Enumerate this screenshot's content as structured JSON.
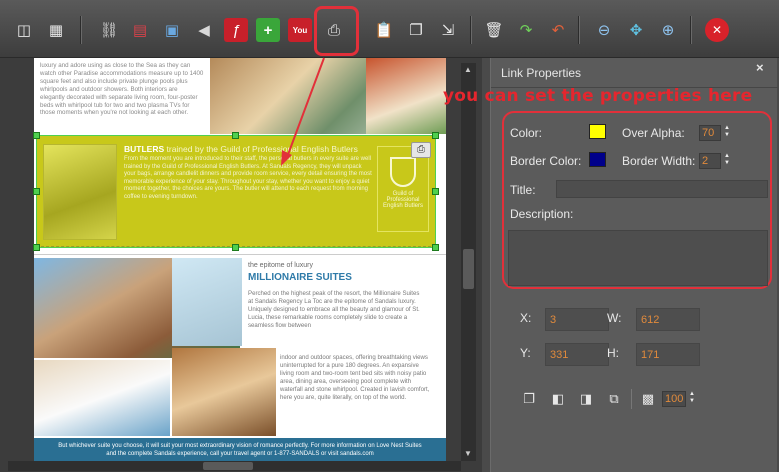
{
  "toolbar": {
    "buttons": [
      {
        "name": "screen-capture-icon",
        "glyph": "◫",
        "color": "#e8e8e8"
      },
      {
        "name": "page-setup-icon",
        "glyph": "▦",
        "color": "#e8e8e8"
      },
      {
        "name": "link-icon",
        "glyph": "⛓",
        "color": "#d8d8d8"
      },
      {
        "name": "video-icon",
        "glyph": "▤",
        "color": "#d8414a"
      },
      {
        "name": "image-icon",
        "glyph": "▣",
        "color": "#6aa8e0"
      },
      {
        "name": "audio-icon",
        "glyph": "◀",
        "color": "#d8d8d8"
      },
      {
        "name": "flash-icon",
        "glyph": "ƒ",
        "color": "#ffffff"
      },
      {
        "name": "add-icon",
        "glyph": "+",
        "color": "#ffffff"
      },
      {
        "name": "youtube-icon",
        "glyph": "You",
        "color": "#ffffff"
      },
      {
        "name": "print-icon",
        "glyph": "⎙",
        "color": "#e8e8e8"
      },
      {
        "name": "paste-icon",
        "glyph": "📋",
        "color": "#e6c66a"
      },
      {
        "name": "copy-icon",
        "glyph": "❐",
        "color": "#e8e8e8"
      },
      {
        "name": "export-icon",
        "glyph": "⇲",
        "color": "#e8e8e8"
      },
      {
        "name": "delete-icon",
        "glyph": "🗑",
        "color": "#e8e8e8"
      },
      {
        "name": "redo-icon",
        "glyph": "↷",
        "color": "#6fd05a"
      },
      {
        "name": "undo-icon",
        "glyph": "↶",
        "color": "#e0603a"
      },
      {
        "name": "zoom-out-icon",
        "glyph": "⊖",
        "color": "#8fc4f0"
      },
      {
        "name": "fit-icon",
        "glyph": "✥",
        "color": "#5fc0e0"
      },
      {
        "name": "zoom-in-icon",
        "glyph": "⊕",
        "color": "#8fc4f0"
      },
      {
        "name": "close-icon",
        "glyph": "✕",
        "color": "#ffffff"
      }
    ]
  },
  "page": {
    "top_text": "luxury and adore using as close to the Sea as they can watch other Paradise accommodations measure up to 1400 square feet and also include private plunge pools plus whirlpools and outdoor showers. Both interiors are elegantly decorated with separate living room, four-poster beds with whirlpool tub for two and two plasma TVs for those moments when you're not looking at each other.",
    "butler_title_main": "BUTLERS",
    "butler_title_rest": " trained by the Guild of Professional English Butlers",
    "butler_text": "From the moment you are introduced to their staff, the personal butlers in every suite are well trained by the Guild of Professional English Butlers. At Sandals Regency, they will unpack your bags, arrange candlelit dinners and provide room service, every detail ensuring the most memorable experience of your stay. Throughout your stay, whether you want to enjoy a quiet moment together, the choices are yours. The butler will attend to each request from morning coffee to evening turndown.",
    "crest_text": "Guild of Professional English Butlers",
    "sub_heading": "the epitome of luxury",
    "headline": "MILLIONAIRE SUITES",
    "body_text": "Perched on the highest peak of the resort, the Millionaire Suites at Sandals Regency La Toc are the epitome of Sandals luxury. Uniquely designed to embrace all the beauty and glamour of St. Lucia, these remarkable rooms completely slide to create a seamless flow between",
    "body_text_2": "indoor and outdoor spaces, offering breathtaking views uninterrupted for a pure 180 degrees. An expansive living room and two-room tent bed sits with noisy patio area, dining area, overseeing pool complete with waterfall and stone whirlpool. Created in lavish comfort, here you are, quite literally, on top of the world.",
    "footer_line1": "But whichever suite you choose, it will suit your most extraordinary vision of romance perfectly. For more information on Love Nest Suites",
    "footer_line2": "and the complete Sandals experience, call your travel agent or 1-877-SANDALS or visit sandals.com"
  },
  "annotation": "you can set the properties here",
  "panel": {
    "title": "Link Properties",
    "close_glyph": "×",
    "color_label": "Color:",
    "color_value": "#ffff00",
    "over_alpha_label": "Over Alpha:",
    "over_alpha_value": "70",
    "border_color_label": "Border Color:",
    "border_color_value": "#00008b",
    "border_width_label": "Border Width:",
    "border_width_value": "2",
    "title_label": "Title:",
    "title_value": "",
    "description_label": "Description:",
    "description_value": "",
    "x_label": "X:",
    "x_value": "3",
    "w_label": "W:",
    "w_value": "612",
    "y_label": "Y:",
    "y_value": "331",
    "h_label": "H:",
    "h_value": "171",
    "opacity_value": "100"
  },
  "colors": {
    "accent_red": "#e2303a",
    "value_orange": "#e08a3c",
    "selection_green": "#4fd04f"
  }
}
